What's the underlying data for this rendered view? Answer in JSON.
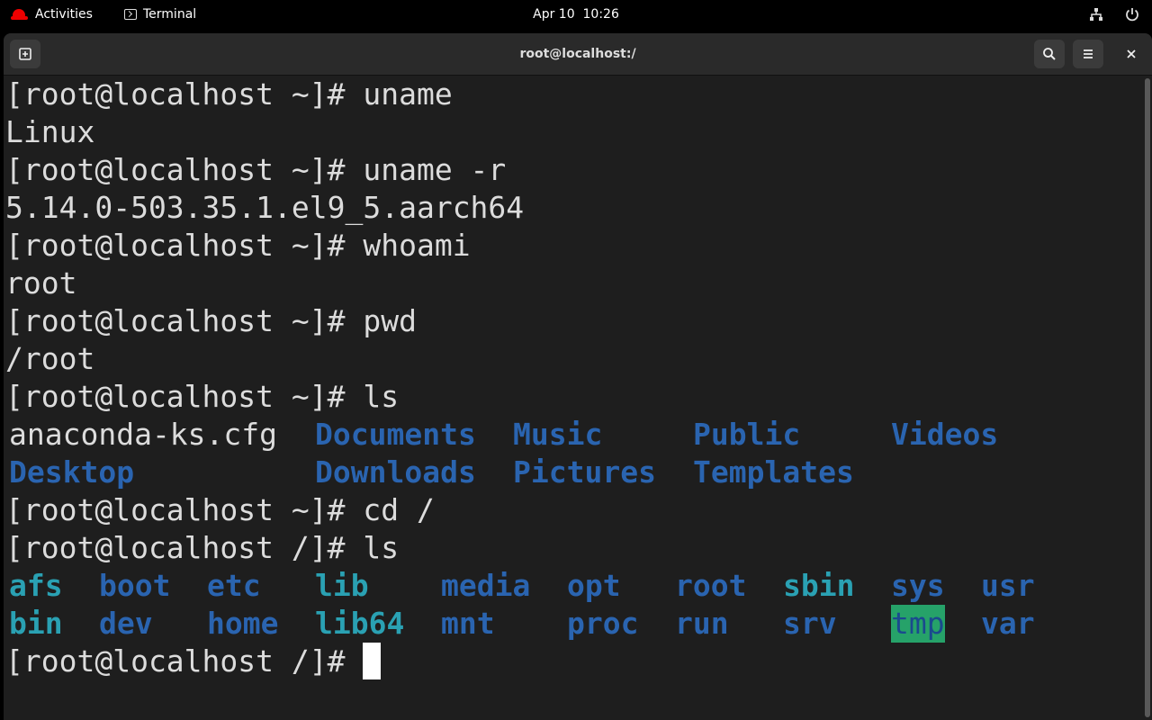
{
  "topbar": {
    "activities": "Activities",
    "app_name": "Terminal",
    "clock": "Apr 10  10:26"
  },
  "window": {
    "title": "root@localhost:/"
  },
  "terminal": {
    "lines": {
      "l0": "[root@localhost ~]# uname",
      "l1": "Linux",
      "l2": "[root@localhost ~]# uname -r",
      "l3": "5.14.0-503.35.1.el9_5.aarch64",
      "l4": "[root@localhost ~]# whoami",
      "l5": "root",
      "l6": "[root@localhost ~]# pwd",
      "l7": "/root",
      "l8": "[root@localhost ~]# ls",
      "l11": "[root@localhost ~]# cd /",
      "l12": "[root@localhost /]# ls",
      "l15": "[root@localhost /]# "
    },
    "home_ls": {
      "row1": [
        "anaconda-ks.cfg",
        "Documents",
        "Music",
        "Public",
        "Videos"
      ],
      "row2": [
        "Desktop",
        "Downloads",
        "Pictures",
        "Templates"
      ]
    },
    "root_ls": {
      "row1": [
        "afs",
        "boot",
        "etc",
        "lib",
        "media",
        "opt",
        "root",
        "sbin",
        "sys",
        "usr"
      ],
      "row2": [
        "bin",
        "dev",
        "home",
        "lib64",
        "mnt",
        "proc",
        "run",
        "srv",
        "tmp",
        "var"
      ]
    }
  },
  "colors": {
    "directory": "#2a64b0",
    "symlink": "#2aa1b3",
    "sticky_dir_bg": "#26a269",
    "terminal_bg": "#1e1e1e"
  },
  "icons": [
    "red-hat-logo",
    "terminal-icon",
    "network-icon",
    "power-icon",
    "new-tab-icon",
    "search-icon",
    "menu-icon",
    "close-icon"
  ]
}
